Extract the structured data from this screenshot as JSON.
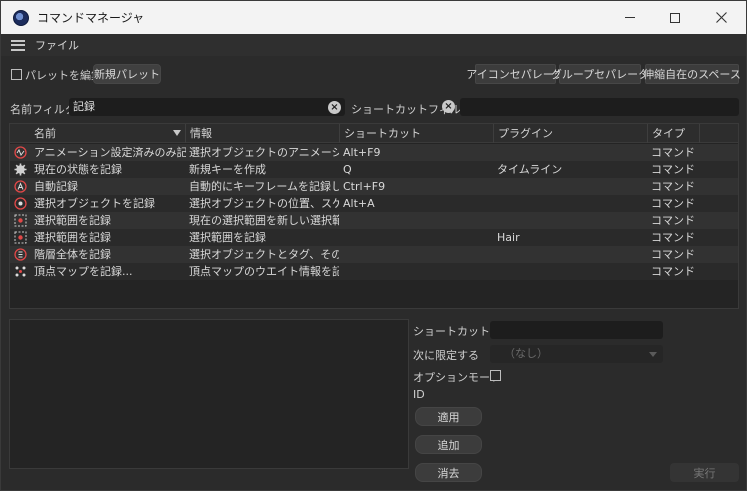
{
  "window": {
    "title": "コマンドマネージャ",
    "controls": {
      "minimize": "minimize",
      "maximize": "maximize",
      "close": "close"
    }
  },
  "menu": {
    "file": "ファイル"
  },
  "toolbar": {
    "edit_palette_label": "パレットを編集",
    "edit_palette_checked": false,
    "new_palette": "新規パレット",
    "icon_separator": "アイコンセパレータ",
    "group_separator": "グループセパレータ",
    "stretch_space": "伸縮自在のスペース"
  },
  "filters": {
    "name_label": "名前フィルタ",
    "name_value": "記録",
    "shortcut_label": "ショートカットフィルタ",
    "shortcut_value": ""
  },
  "table": {
    "headers": {
      "name": "名前",
      "info": "情報",
      "shortcut": "ショートカット",
      "plugin": "プラグイン",
      "type": "タイプ"
    },
    "rows": [
      {
        "icon": "animation-record-icon",
        "name": "アニメーション設定済みのみ記録",
        "info": "選択オブジェクトのアニメーション設定",
        "shortcut": "Alt+F9",
        "plugin": "",
        "type": "コマンド"
      },
      {
        "icon": "gear-record-icon",
        "name": "現在の状態を記録",
        "info": "新規キーを作成",
        "shortcut": "Q",
        "plugin": "タイムライン",
        "type": "コマンド"
      },
      {
        "icon": "auto-record-icon",
        "name": "自動記録",
        "info": "自動的にキーフレームを記録します",
        "shortcut": "Ctrl+F9",
        "plugin": "",
        "type": "コマンド"
      },
      {
        "icon": "record-object-icon",
        "name": "選択オブジェクトを記録",
        "info": "選択オブジェクトの位置、スケール、回",
        "shortcut": "Alt+A",
        "plugin": "",
        "type": "コマンド"
      },
      {
        "icon": "selection-range-icon",
        "name": "選択範囲を記録",
        "info": "現在の選択範囲を新しい選択範囲",
        "shortcut": "",
        "plugin": "",
        "type": "コマンド"
      },
      {
        "icon": "selection-range-icon",
        "name": "選択範囲を記録",
        "info": "選択範囲を記録",
        "shortcut": "",
        "plugin": "Hair",
        "type": "コマンド"
      },
      {
        "icon": "hierarchy-record-icon",
        "name": "階層全体を記録",
        "info": "選択オブジェクトとタグ、その子にキー",
        "shortcut": "",
        "plugin": "",
        "type": "コマンド"
      },
      {
        "icon": "vertex-map-record-icon",
        "name": "頂点マップを記録...",
        "info": "頂点マップのウエイト情報を記録し、",
        "shortcut": "",
        "plugin": "",
        "type": "コマンド"
      }
    ]
  },
  "details": {
    "shortcut_label": "ショートカット",
    "shortcut_value": "",
    "restrict_label": "次に限定する",
    "restrict_value": "（なし）",
    "option_mode_label": "オプションモード",
    "option_mode_checked": false,
    "id_label": "ID",
    "apply": "適用",
    "add": "追加",
    "delete": "消去",
    "execute": "実行"
  },
  "colors": {
    "accent_record": "#e04848",
    "window_bg": "#2b2b2b",
    "titlebar_bg": "#f3f3f3"
  }
}
